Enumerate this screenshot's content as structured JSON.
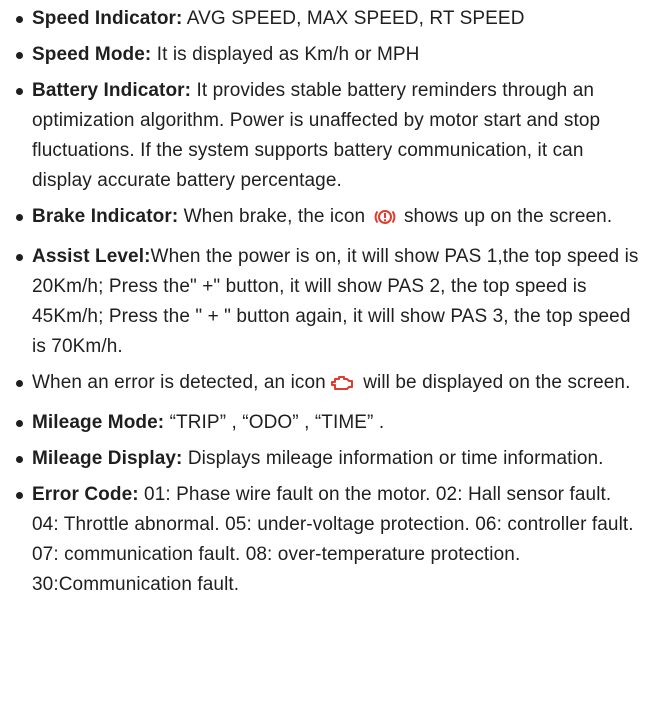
{
  "items": [
    {
      "label": "Speed Indicator:",
      "text": " AVG SPEED, MAX SPEED, RT SPEED"
    },
    {
      "label": "Speed Mode:",
      "text": " It is displayed as Km/h or MPH"
    },
    {
      "label": "Battery Indicator:",
      "text": " It provides stable battery reminders through an optimization algorithm. Power is unaffected by motor start and stop fluctuations. If the system supports battery communication, it can display accurate battery percentage."
    },
    {
      "label": "Brake Indicator:",
      "text_before": " When brake, the icon ",
      "text_after": " shows up on the screen."
    },
    {
      "label": "Assist Level:",
      "text": "When the power is on, it will show PAS 1,the top speed is 20Km/h; Press the\" +\" button, it will show PAS 2, the top speed is 45Km/h; Press the \" + \" button again, it will show PAS 3, the top speed is 70Km/h."
    },
    {
      "text_before": "When an error is detected, an icon",
      "text_after": " will be displayed on the screen."
    },
    {
      "label": "Mileage Mode:",
      "text": " “TRIP” , “ODO” , “TIME” ."
    },
    {
      "label": "Mileage Display:",
      "text": " Displays mileage information or time information."
    },
    {
      "label": "Error Code:",
      "text": " 01: Phase wire fault on the motor. 02: Hall sensor fault. 04: Throttle abnormal. 05: under-voltage protection. 06: controller fault. 07: communication fault. 08: over-temperature protection. 30:Communication fault."
    }
  ],
  "colors": {
    "text": "#1f1f1f",
    "icon_red": "#e23b2e"
  },
  "icons": {
    "brake": "brake-warning-icon",
    "error": "engine-error-icon"
  }
}
